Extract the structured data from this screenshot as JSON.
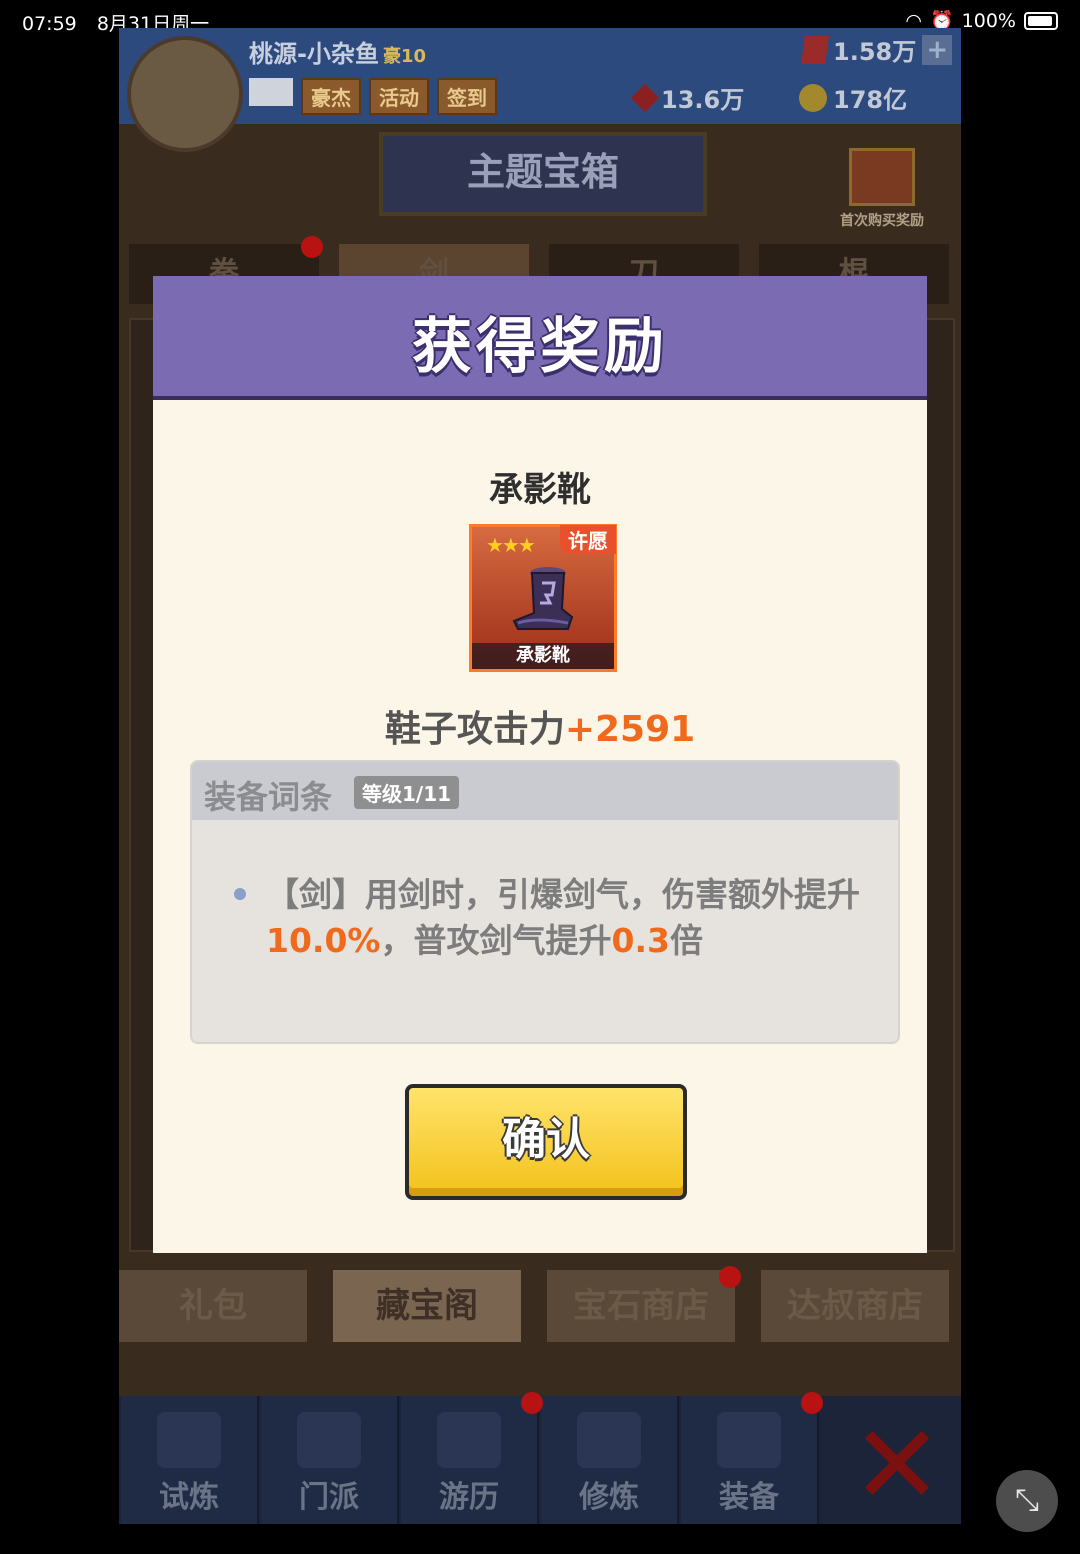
{
  "status_bar": {
    "time": "07:59",
    "date": "8月31日周一",
    "battery": "100%"
  },
  "game": {
    "player": {
      "name": "桃源-小杂鱼",
      "vip": "豪10"
    },
    "top_buttons": [
      "豪杰",
      "活动",
      "签到"
    ],
    "currencies": {
      "gems": "1.58万",
      "tokens": "13.6万",
      "coins": "178亿"
    },
    "page_title": "主题宝箱",
    "first_purchase_label": "首次购买奖励",
    "weapon_tabs": [
      "拳",
      "剑",
      "刀",
      "棍"
    ],
    "shop_tabs": [
      "礼包",
      "藏宝阁",
      "宝石商店",
      "达叔商店"
    ],
    "bottom_nav": [
      "试炼",
      "门派",
      "游历",
      "修炼",
      "装备"
    ]
  },
  "dialog": {
    "title": "获得奖励",
    "item_name": "承影靴",
    "card": {
      "stars": "★★★",
      "badge": "许愿",
      "label": "承影靴"
    },
    "stat_label": "鞋子攻击力",
    "stat_value": "+2591",
    "affix": {
      "title": "装备词条",
      "level": "等级1/11",
      "text_part1": "【剑】用剑时，引爆剑气，伤害额外提升",
      "highlight1": "10.0%",
      "text_part2": "，普攻剑气提升",
      "highlight2": "0.3",
      "text_part3": "倍"
    },
    "confirm_label": "确认"
  }
}
